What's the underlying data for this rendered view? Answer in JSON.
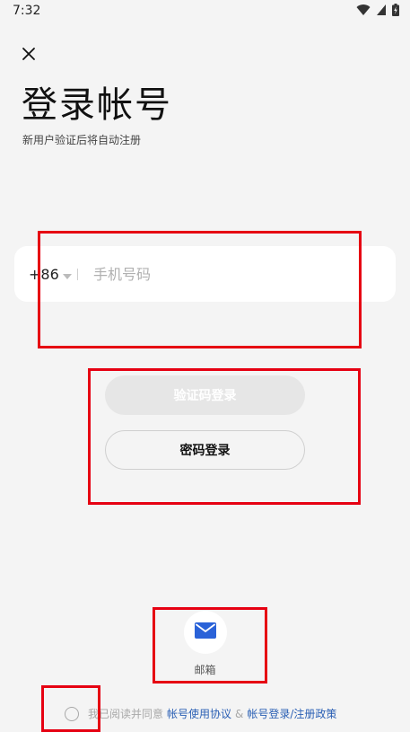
{
  "status_bar": {
    "time": "7:32"
  },
  "header": {
    "title": "登录帐号",
    "subtitle": "新用户验证后将自动注册"
  },
  "phone": {
    "country_code": "+86",
    "placeholder": "手机号码"
  },
  "buttons": {
    "code_login": "验证码登录",
    "password_login": "密码登录"
  },
  "alt_login": {
    "email_label": "邮箱"
  },
  "agreement": {
    "prefix": "我已阅读并同意",
    "link_terms": "帐号使用协议",
    "amp": "&",
    "link_policy": "帐号登录/注册政策"
  },
  "colors": {
    "background": "#f4f4f4",
    "link": "#2a5fb4",
    "email_icon": "#2a62d8",
    "highlight_box": "#e60012",
    "disabled_button": "#e6e6e6"
  }
}
